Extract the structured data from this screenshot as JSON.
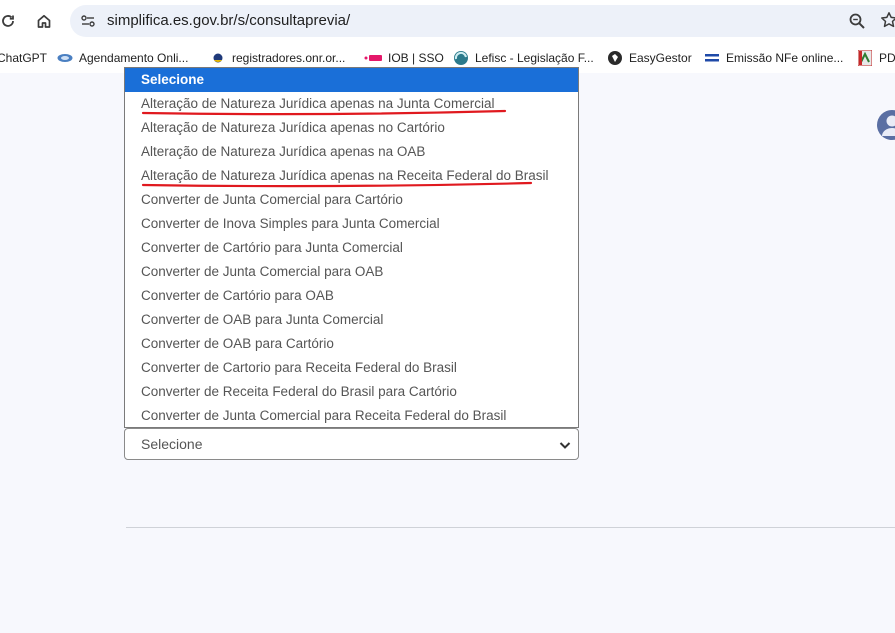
{
  "browser": {
    "url": "simplifica.es.gov.br/s/consultaprevia/",
    "bookmarks": [
      {
        "label": "ChatGPT",
        "icon": "chatgpt-icon"
      },
      {
        "label": "Agendamento Onli...",
        "icon": "agendamento-icon"
      },
      {
        "label": "registradores.onr.or...",
        "icon": "registradores-icon"
      },
      {
        "label": "IOB | SSO",
        "icon": "iob-icon"
      },
      {
        "label": "Lefisc - Legislação F...",
        "icon": "lefisc-icon"
      },
      {
        "label": "EasyGestor",
        "icon": "easygestor-icon"
      },
      {
        "label": "Emissão NFe online...",
        "icon": "nfe-icon"
      },
      {
        "label": "PDF",
        "icon": "pdf-icon"
      }
    ]
  },
  "dropdown": {
    "options": [
      "Selecione",
      "Alteração de Natureza Jurídica apenas na Junta Comercial",
      "Alteração de Natureza Jurídica apenas no Cartório",
      "Alteração de Natureza Jurídica apenas na OAB",
      "Alteração de Natureza Jurídica apenas na Receita Federal do Brasil",
      "Converter de Junta Comercial para Cartório",
      "Converter de Inova Simples para Junta Comercial",
      "Converter de Cartório para Junta Comercial",
      "Converter de Junta Comercial para OAB",
      "Converter de Cartório para OAB",
      "Converter de OAB para Junta Comercial",
      "Converter de OAB para Cartório",
      "Converter de Cartorio para Receita Federal do Brasil",
      "Converter de Receita Federal do Brasil para Cartório",
      "Converter de Junta Comercial para Receita Federal do Brasil"
    ],
    "highlighted_option": "Selecione",
    "selected_value": "Selecione",
    "annotated_options": [
      "Alteração de Natureza Jurídica apenas na Junta Comercial",
      "Alteração de Natureza Jurídica apenas na Receita Federal do Brasil"
    ]
  },
  "colors": {
    "highlight": "#1a6fd8",
    "annotation": "#e0191f",
    "page_background": "#f7f8fd"
  }
}
